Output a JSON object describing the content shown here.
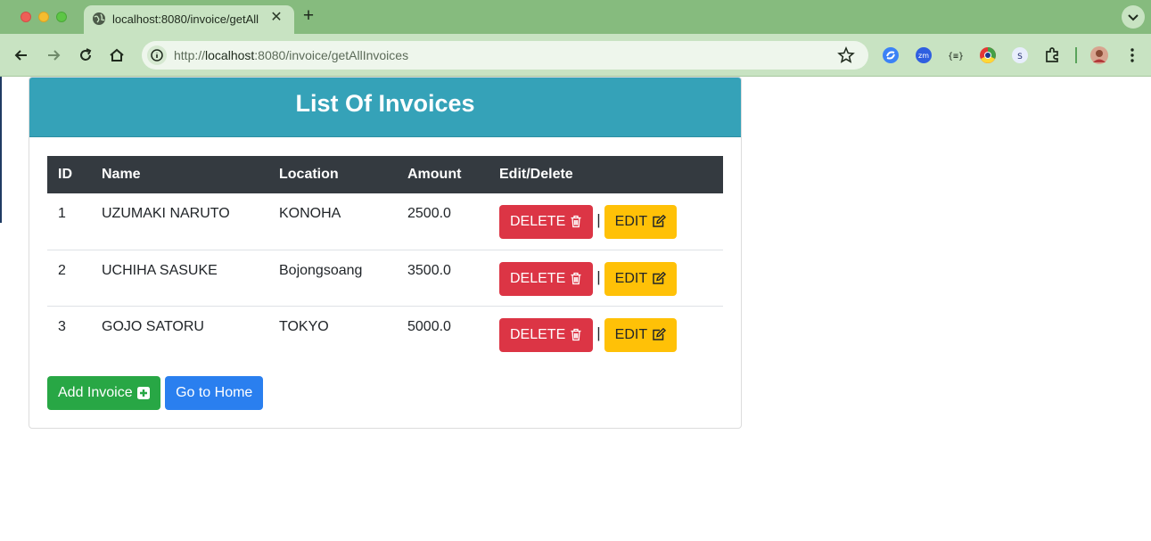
{
  "browser": {
    "tab_title": "localhost:8080/invoice/getAll",
    "url_scheme": "http://",
    "url_host": "localhost",
    "url_rest": ":8080/invoice/getAllInvoices"
  },
  "page": {
    "title": "List Of Invoices",
    "table": {
      "headers": [
        "ID",
        "Name",
        "Location",
        "Amount",
        "Edit/Delete"
      ],
      "rows": [
        {
          "id": "1",
          "name": "UZUMAKI NARUTO",
          "location": "KONOHA",
          "amount": "2500.0"
        },
        {
          "id": "2",
          "name": "UCHIHA SASUKE",
          "location": "Bojongsoang",
          "amount": "3500.0"
        },
        {
          "id": "3",
          "name": "GOJO SATORU",
          "location": "TOKYO",
          "amount": "5000.0"
        }
      ],
      "delete_label": "DELETE",
      "edit_label": "EDIT",
      "separator": "|"
    },
    "add_button": "Add Invoice",
    "home_button": "Go to Home"
  },
  "colors": {
    "header_bg": "#35a2b8",
    "table_head_bg": "#343a40",
    "danger": "#dc3545",
    "warning": "#ffc107",
    "success": "#28a745",
    "primary": "#2a7fef"
  },
  "icons": {
    "tab_favicon": "globe-icon",
    "delete": "trash-icon",
    "edit": "edit-icon",
    "add": "plus-square-icon"
  }
}
